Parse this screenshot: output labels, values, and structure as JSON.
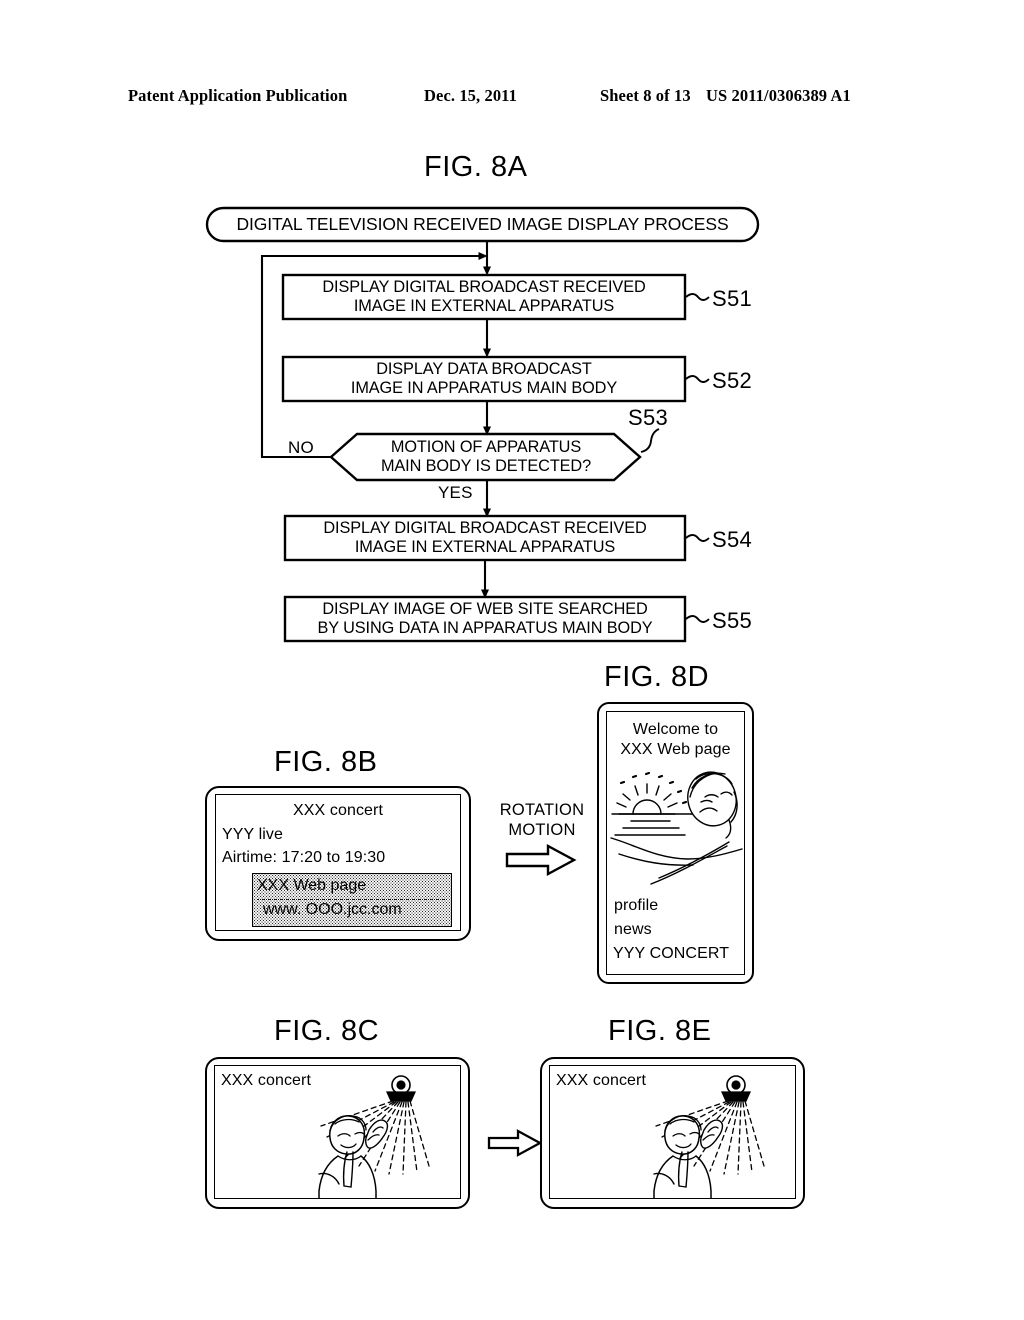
{
  "header": {
    "publication": "Patent Application Publication",
    "date": "Dec. 15, 2011",
    "sheet": "Sheet 8 of 13",
    "patent_number": "US 2011/0306389 A1"
  },
  "figures": {
    "fig8a": {
      "label": "FIG. 8A",
      "terminator": "DIGITAL TELEVISION RECEIVED IMAGE DISPLAY PROCESS",
      "steps": [
        {
          "id": "S51",
          "text": "DISPLAY DIGITAL BROADCAST RECEIVED\nIMAGE IN EXTERNAL APPARATUS"
        },
        {
          "id": "S52",
          "text": "DISPLAY DATA BROADCAST\nIMAGE IN APPARATUS MAIN BODY"
        },
        {
          "id": "S53",
          "text": "MOTION OF APPARATUS\nMAIN BODY IS DETECTED?"
        },
        {
          "id": "S54",
          "text": "DISPLAY DIGITAL BROADCAST RECEIVED\nIMAGE IN EXTERNAL APPARATUS"
        },
        {
          "id": "S55",
          "text": "DISPLAY IMAGE OF WEB SITE SEARCHED\nBY USING DATA IN APPARATUS MAIN BODY"
        }
      ],
      "branch_no": "NO",
      "branch_yes": "YES"
    },
    "fig8b": {
      "label": "FIG. 8B",
      "title": "XXX concert",
      "line1": "YYY live",
      "line2": "Airtime: 17:20 to 19:30",
      "web_label": "XXX Web page",
      "web_url": "www. OOO.jcc.com"
    },
    "fig8c": {
      "label": "FIG. 8C",
      "title": "XXX concert"
    },
    "fig8d": {
      "label": "FIG. 8D",
      "welcome_line1": "Welcome to",
      "welcome_line2": "XXX Web page",
      "menu": [
        "profile",
        "news",
        "YYY CONCERT"
      ]
    },
    "fig8e": {
      "label": "FIG. 8E",
      "title": "XXX concert"
    }
  },
  "transitions": {
    "rotation": "ROTATION\nMOTION"
  },
  "colors": {
    "ink": "#000000",
    "paper": "#ffffff"
  }
}
